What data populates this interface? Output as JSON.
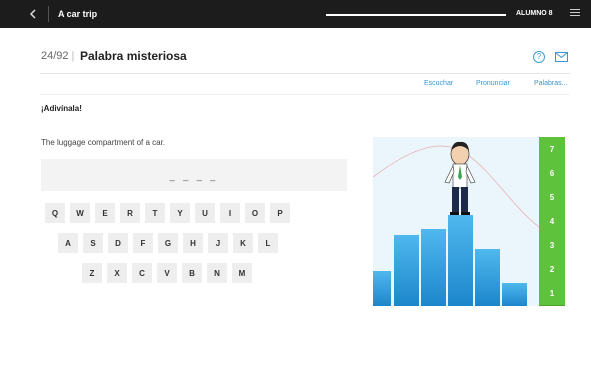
{
  "topbar": {
    "back_icon": "chevron-left-icon",
    "title": "A car trip",
    "user": "ALUMNO 8",
    "menu_icon": "hamburger-menu-icon"
  },
  "header": {
    "counter": "24/92",
    "title": "Palabra misteriosa",
    "help_icon": "question-circle-icon",
    "mail_icon": "envelope-icon",
    "accent_color": "#3a96d0"
  },
  "links": [
    "Escuchar",
    "Pronunciar",
    "Palabras..."
  ],
  "exercise": {
    "heading": "¡Adivínala!",
    "clue": "The luggage compartment of a car.",
    "answer_blanks": "_ _ _ _"
  },
  "keyboard": {
    "row1": [
      "Q",
      "W",
      "E",
      "R",
      "T",
      "Y",
      "U",
      "I",
      "O",
      "P"
    ],
    "row2": [
      "A",
      "S",
      "D",
      "F",
      "G",
      "H",
      "J",
      "K",
      "L"
    ],
    "row3": [
      "Z",
      "X",
      "C",
      "V",
      "B",
      "N",
      "M"
    ]
  },
  "scale": {
    "levels": [
      "7",
      "6",
      "5",
      "4",
      "3",
      "2",
      "1"
    ],
    "color": "#5fc23c"
  },
  "scene": {
    "bar_color": "#2a9ee0",
    "sky_color": "#eaf6fc"
  }
}
